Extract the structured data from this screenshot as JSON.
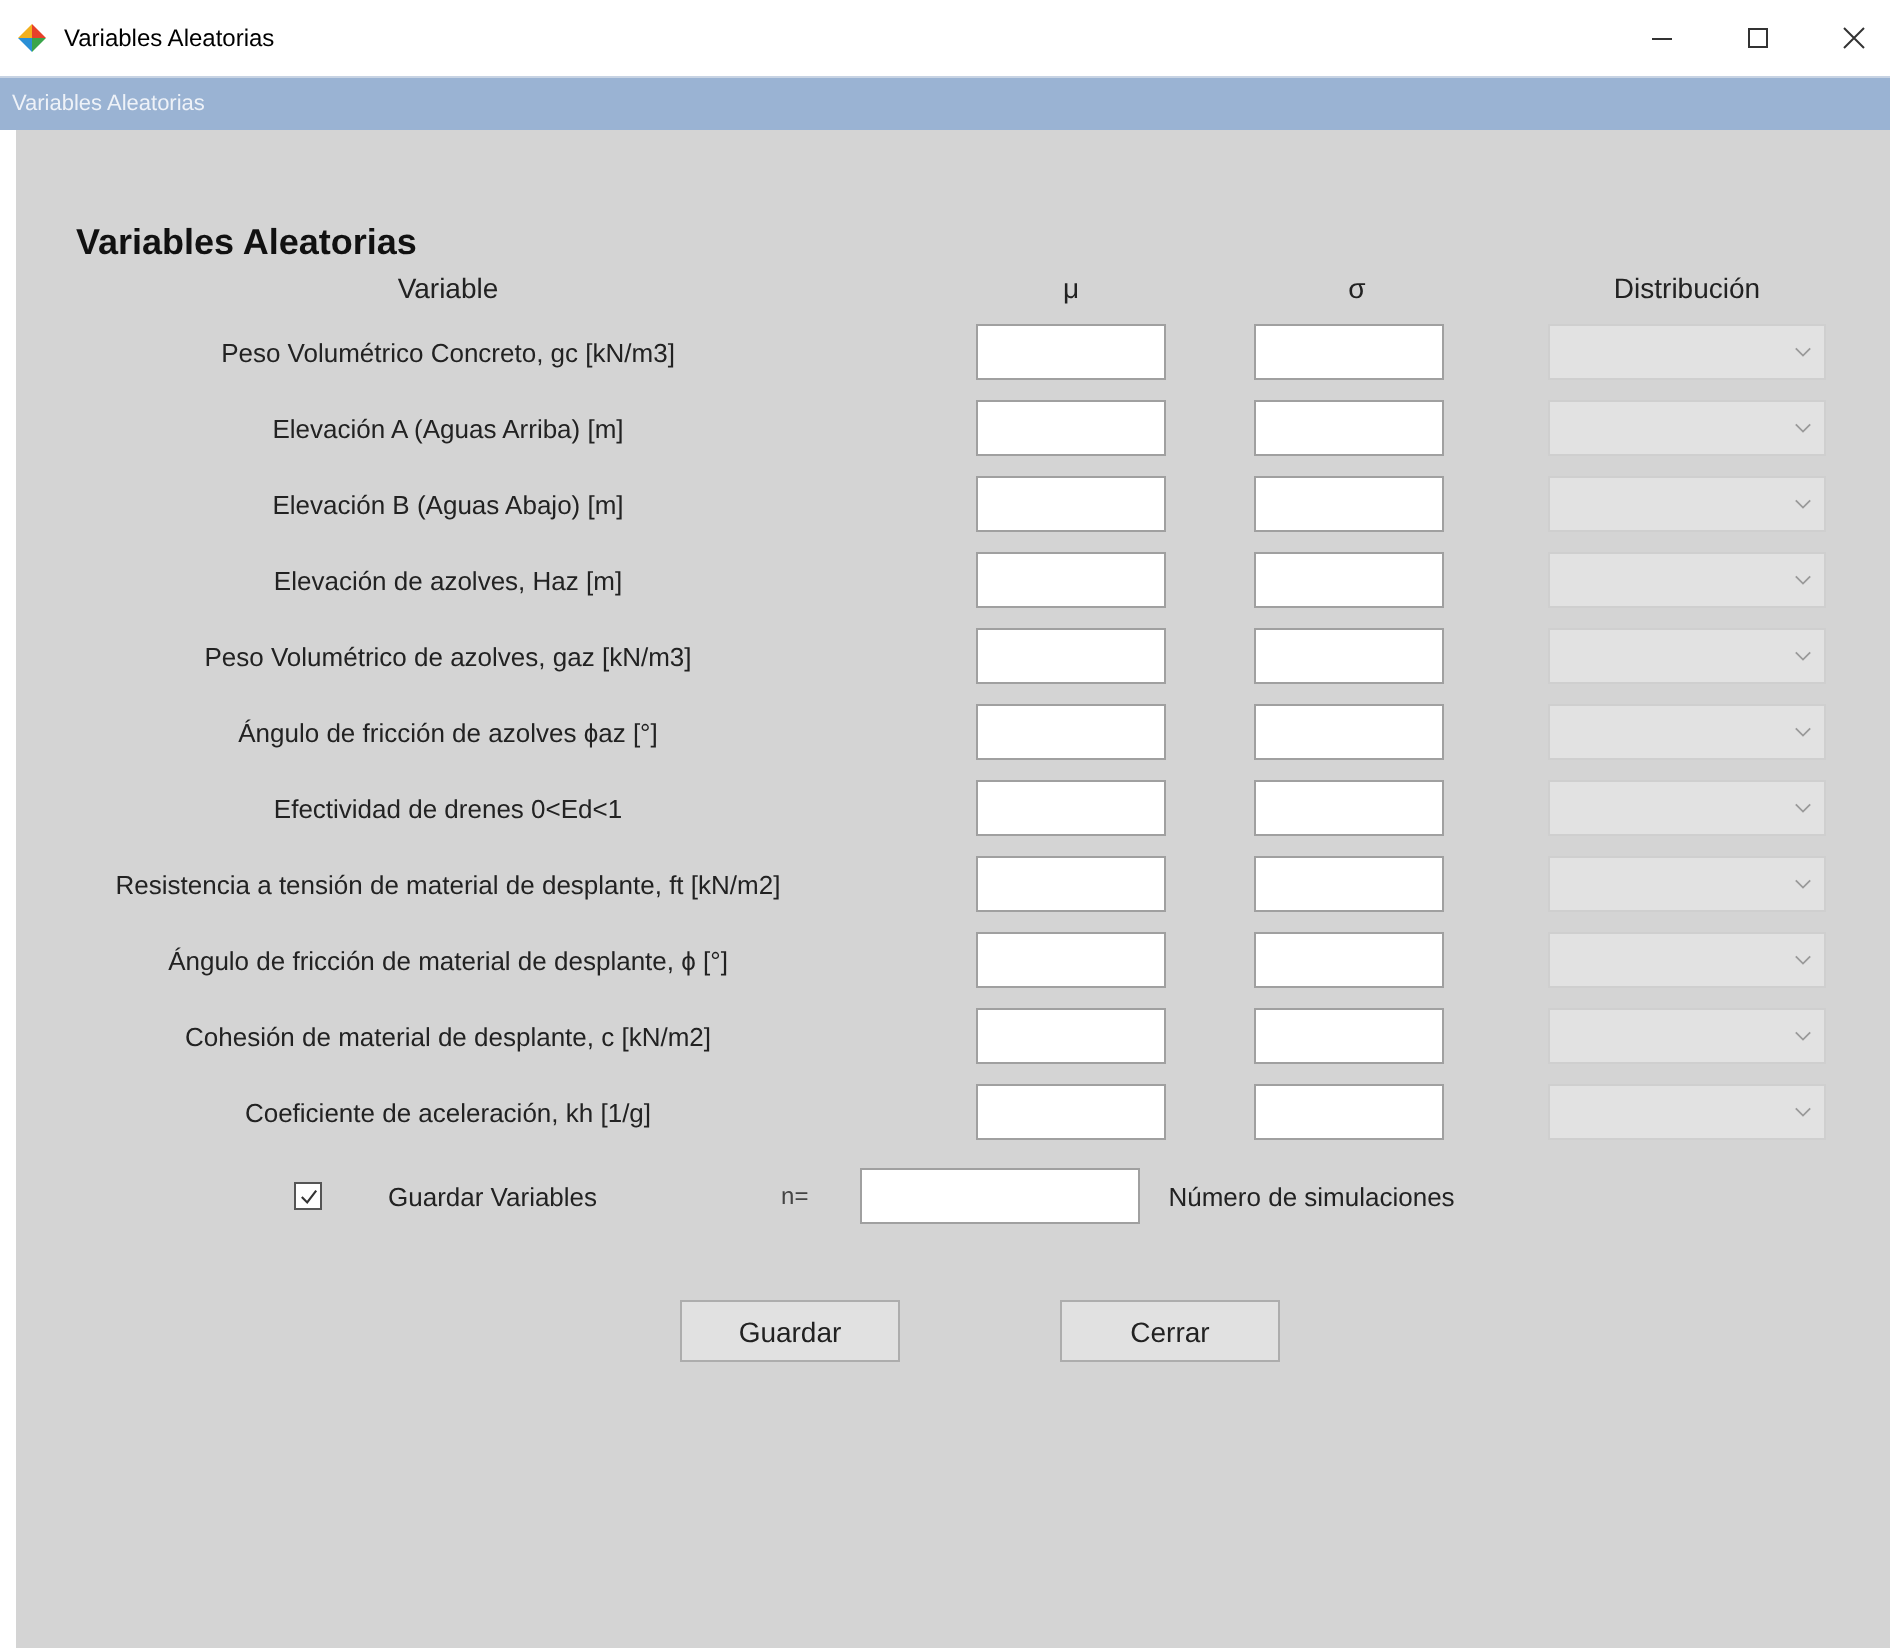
{
  "window": {
    "title": "Variables Aleatorias"
  },
  "panel_header": "Variables Aleatorias",
  "heading": "Variables Aleatorias",
  "columns": [
    "Variable",
    "μ",
    "σ",
    "Distribución"
  ],
  "rows": [
    {
      "label": "Peso Volumétrico Concreto, gc [kN/m3]",
      "distribution_disabled": true
    },
    {
      "label": "Elevación A (Aguas Arriba) [m]",
      "distribution_disabled": true
    },
    {
      "label": "Elevación B (Aguas Abajo) [m]",
      "distribution_disabled": true
    },
    {
      "label": "Elevación de azolves, Haz [m]",
      "distribution_disabled": true
    },
    {
      "label": "Peso Volumétrico de azolves, gaz [kN/m3]",
      "distribution_disabled": true
    },
    {
      "label": "Ángulo de fricción de azolves ϕaz [°]",
      "distribution_disabled": true
    },
    {
      "label": "Efectividad de drenes 0<Ed<1",
      "distribution_disabled": true
    },
    {
      "label": "Resistencia a tensión de material de desplante, ft [kN/m2]",
      "distribution_disabled": true
    },
    {
      "label": "Ángulo de fricción de material de desplante, ϕ [°]",
      "distribution_disabled": true
    },
    {
      "label": "Cohesión de material de desplante, c [kN/m2]",
      "distribution_disabled": true
    },
    {
      "label": "Coeficiente de aceleración, kh [1/g]",
      "distribution_disabled": true
    }
  ],
  "save_variables": {
    "label": "Guardar Variables",
    "checked": true
  },
  "simulations": {
    "prefix": "n=",
    "label": "Número de simulaciones"
  },
  "buttons": [
    "Guardar",
    "Cerrar"
  ]
}
